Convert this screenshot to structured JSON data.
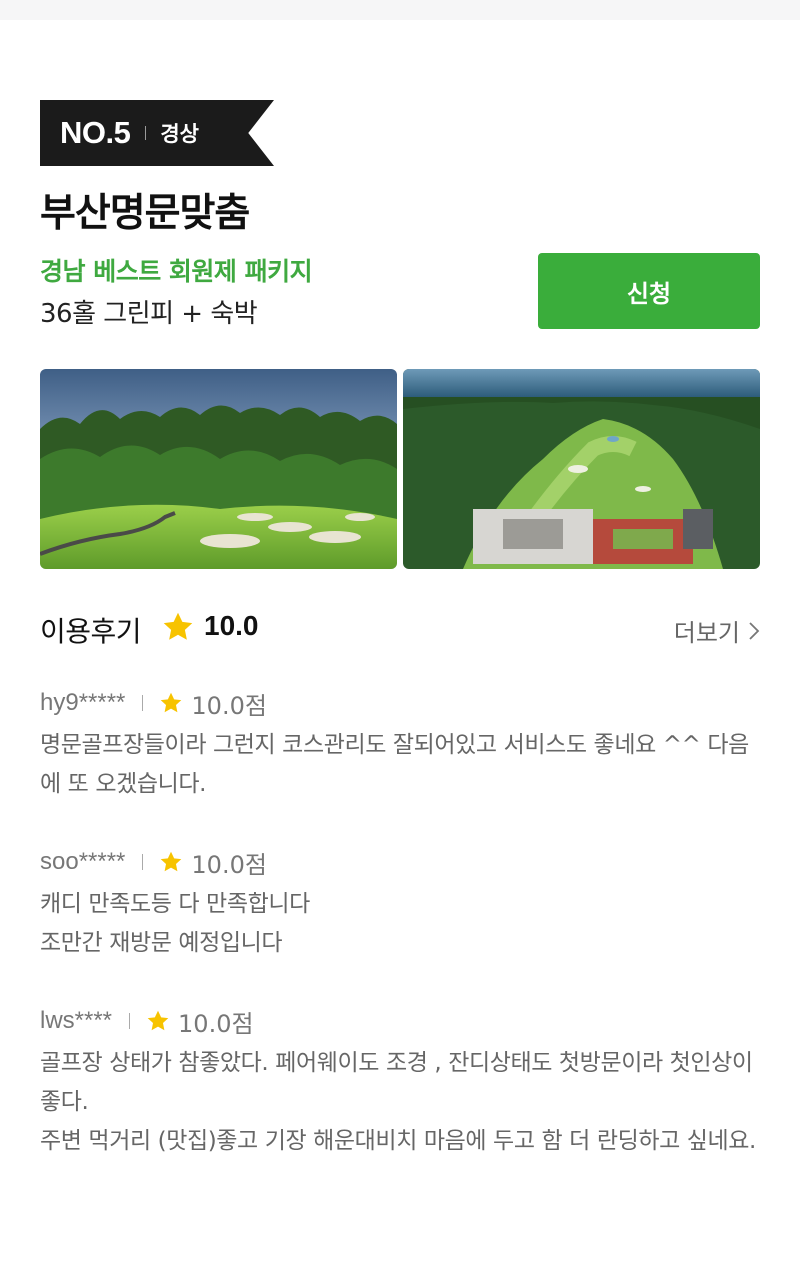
{
  "header": {
    "rank": "NO.5",
    "region": "경상"
  },
  "product": {
    "title": "부산명문맞춤",
    "subtitle": "경남 베스트 회원제 패키지",
    "description": "36홀 그린피 + 숙박",
    "apply_label": "신청"
  },
  "colors": {
    "accent_green": "#3aad3b",
    "subtitle_green": "#3fa940",
    "star": "#f7c300",
    "badge_bg": "#1b1b1b"
  },
  "reviews": {
    "title": "이용후기",
    "average": "10.0",
    "more_label": "더보기",
    "items": [
      {
        "user": "hy9*****",
        "score": "10.0점",
        "text": "명문골프장들이라 그런지 코스관리도 잘되어있고 서비스도 좋네요 ^^ 다음에 또 오겠습니다."
      },
      {
        "user": "soo*****",
        "score": "10.0점",
        "text": "캐디 만족도등 다 만족합니다\n 조만간 재방문 예정입니다"
      },
      {
        "user": "lws****",
        "score": "10.0점",
        "text": "골프장 상태가 참좋았다. 페어웨이도 조경 , 잔디상태도 첫방문이라 첫인상이 좋다.\n 주변 먹거리 (맛집)좋고 기장 해운대비치 마음에 두고 함 더 란딩하고 싶네요."
      }
    ]
  }
}
